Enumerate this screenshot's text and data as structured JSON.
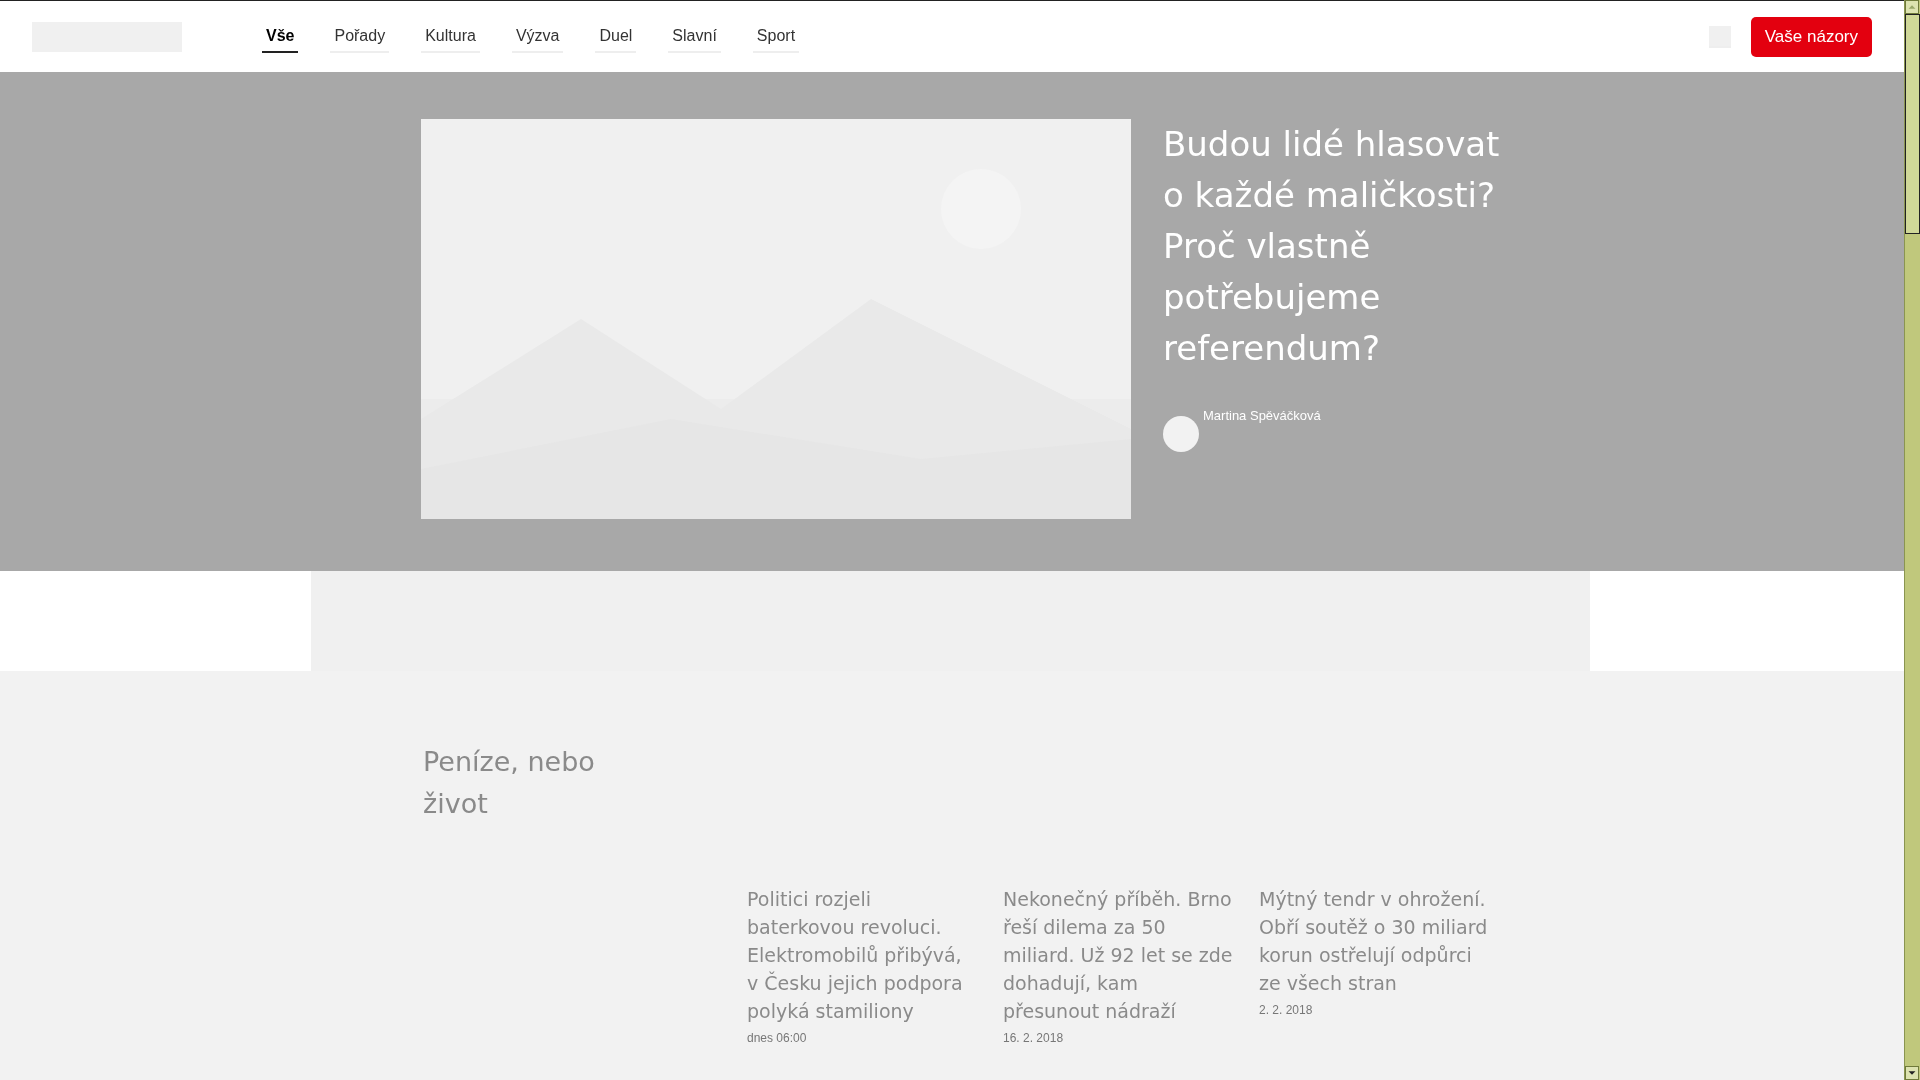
{
  "nav": {
    "tabs": [
      {
        "label": "Vše",
        "selected": true
      },
      {
        "label": "Pořady",
        "selected": false
      },
      {
        "label": "Kultura",
        "selected": false
      },
      {
        "label": "Výzva",
        "selected": false
      },
      {
        "label": "Duel",
        "selected": false
      },
      {
        "label": "Slavní",
        "selected": false
      },
      {
        "label": "Sport",
        "selected": false
      }
    ],
    "cta_button": "Vaše názory"
  },
  "hero": {
    "title": "Budou lidé hlasovat o každé maličkosti? Proč vlastně potřebujeme referendum?",
    "author": "Martina Spěváčková"
  },
  "section": {
    "title": "Peníze, nebo život",
    "articles": [
      {
        "title": "Politici rozjeli baterkovou revoluci. Elektromobilů přibývá, v Česku jejich podpora polyká stamiliony",
        "date": "dnes 06:00"
      },
      {
        "title": "Nekonečný příběh. Brno řeší dilema za 50 miliard. Už 92 let se zde dohadují, kam přesunout nádraží",
        "date": "16. 2. 2018"
      },
      {
        "title": "Mýtný tendr v ohrožení. Obří soutěž o 30 miliard korun ostřelují odpůrci ze všech stran",
        "date": "2. 2. 2018"
      }
    ]
  }
}
